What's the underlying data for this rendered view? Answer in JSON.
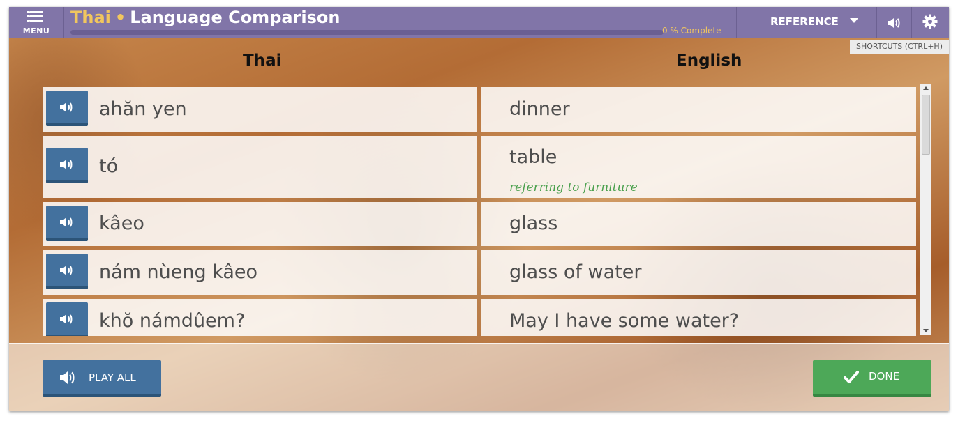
{
  "header": {
    "menu_label": "MENU",
    "language": "Thai",
    "separator": "•",
    "title": "Language Comparison",
    "progress_percent": 0,
    "progress_text": "0 % Complete",
    "reference_label": "REFERENCE",
    "shortcuts_tooltip": "SHORTCUTS (CTRL+H)"
  },
  "columns": {
    "left": "Thai",
    "right": "English"
  },
  "rows": [
    {
      "thai": "ahăn yen",
      "english": "dinner",
      "note": ""
    },
    {
      "thai": "tó",
      "english": "table",
      "note": "referring to furniture"
    },
    {
      "thai": "kâeo",
      "english": "glass",
      "note": ""
    },
    {
      "thai": "nám nùeng kâeo",
      "english": "glass of water",
      "note": ""
    },
    {
      "thai": "khŏ námdûem?",
      "english": "May I have some water?",
      "note": ""
    }
  ],
  "footer": {
    "play_all_label": "PLAY ALL",
    "done_label": "DONE"
  },
  "icons": {
    "menu": "menu-icon",
    "speaker": "speaker-icon",
    "settings": "gear-icon",
    "caret": "caret-down-icon",
    "check": "checkmark-icon"
  },
  "colors": {
    "topbar": "#8175a8",
    "accent_yellow": "#f1c65e",
    "play_blue": "#43719e",
    "done_green": "#4da858",
    "note_green": "#4aa04d"
  }
}
